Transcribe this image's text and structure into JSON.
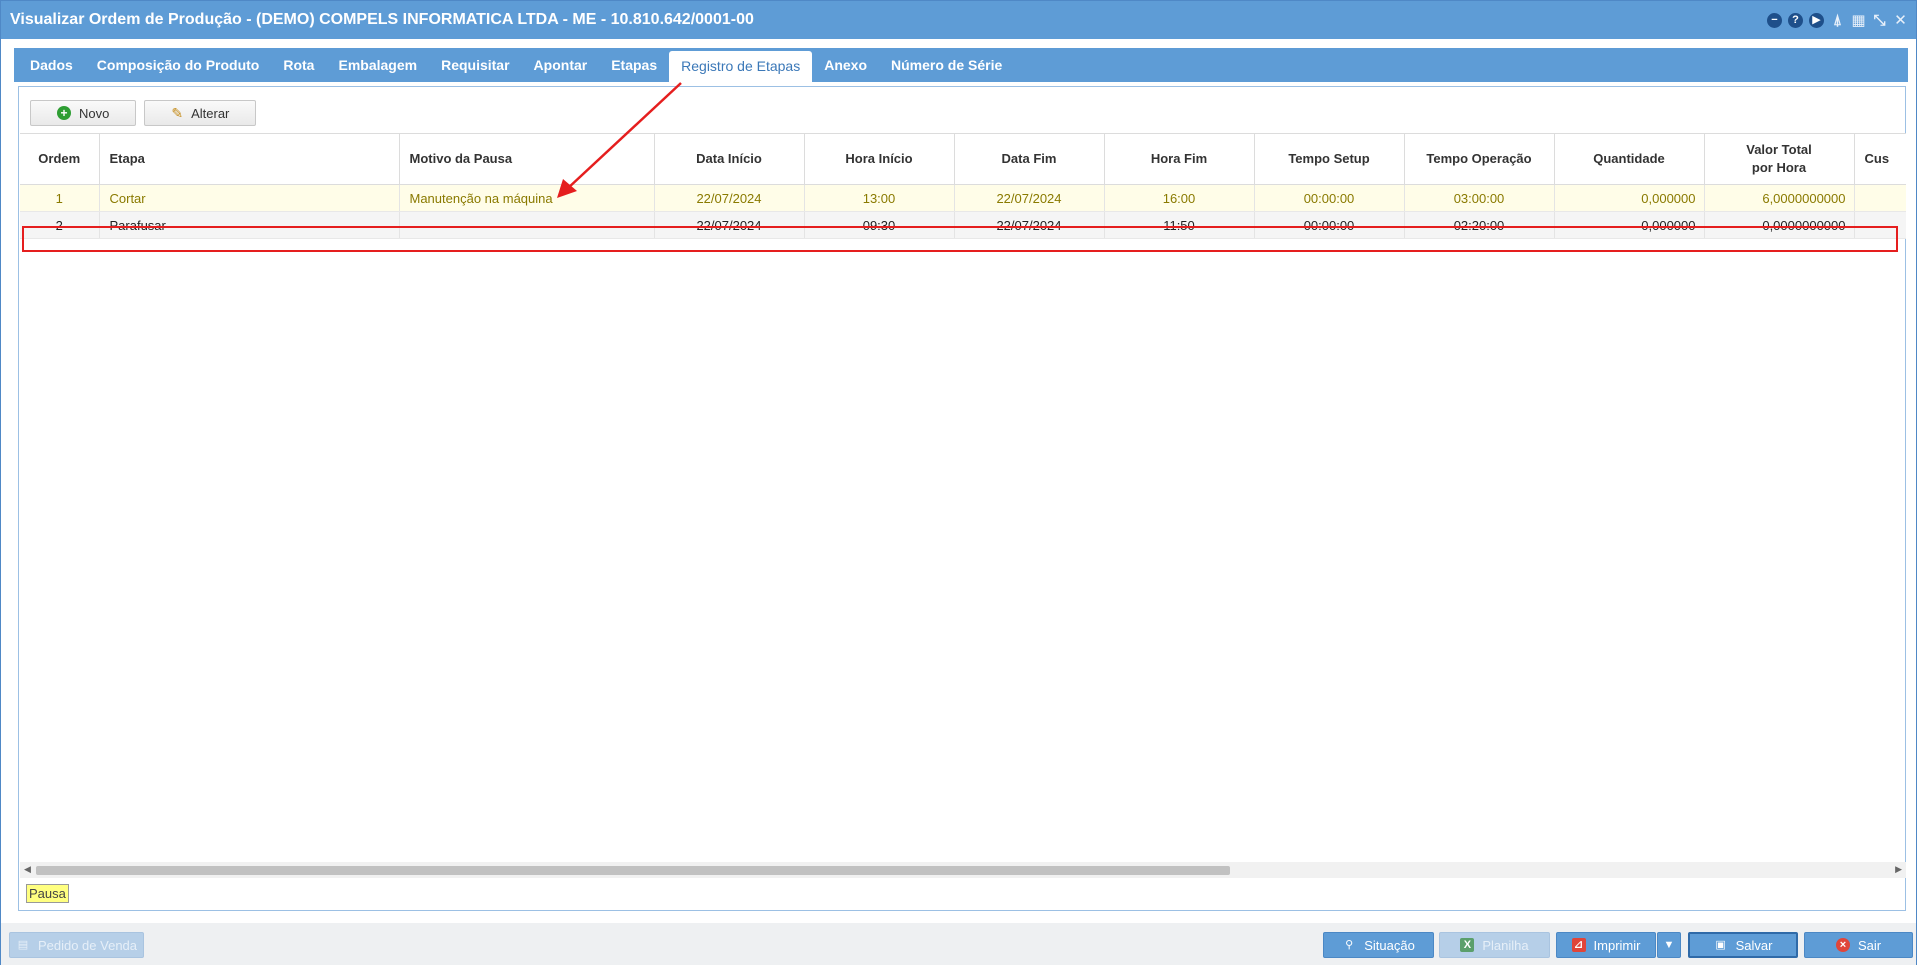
{
  "window": {
    "title": "Visualizar Ordem de Produção - (DEMO) COMPELS INFORMATICA LTDA - ME - 10.810.642/0001-00",
    "icons": [
      "minimize-circle-icon",
      "help-icon",
      "play-icon",
      "bell-icon",
      "calendar-icon",
      "collapse-icon",
      "close-icon"
    ]
  },
  "tabs": [
    {
      "label": "Dados"
    },
    {
      "label": "Composição do Produto"
    },
    {
      "label": "Rota"
    },
    {
      "label": "Embalagem"
    },
    {
      "label": "Requisitar"
    },
    {
      "label": "Apontar"
    },
    {
      "label": "Etapas"
    },
    {
      "label": "Registro de Etapas",
      "active": true
    },
    {
      "label": "Anexo"
    },
    {
      "label": "Número de Série"
    }
  ],
  "toolbar": {
    "new_label": "Novo",
    "edit_label": "Alterar"
  },
  "table": {
    "columns": [
      "Ordem",
      "Etapa",
      "Motivo da Pausa",
      "Data Início",
      "Hora Início",
      "Data Fim",
      "Hora Fim",
      "Tempo Setup",
      "Tempo Operação",
      "Quantidade",
      "Valor Total\npor Hora",
      "Cus"
    ],
    "rows": [
      {
        "ordem": "1",
        "etapa": "Cortar",
        "motivo": "Manutenção na máquina",
        "data_inicio": "22/07/2024",
        "hora_inicio": "13:00",
        "data_fim": "22/07/2024",
        "hora_fim": "16:00",
        "tempo_setup": "00:00:00",
        "tempo_operacao": "03:00:00",
        "quantidade": "0,000000",
        "valor_total": "6,0000000000",
        "status": "paused"
      },
      {
        "ordem": "2",
        "etapa": "Parafusar",
        "motivo": "",
        "data_inicio": "22/07/2024",
        "hora_inicio": "09:30",
        "data_fim": "22/07/2024",
        "hora_fim": "11:50",
        "tempo_setup": "00:00:00",
        "tempo_operacao": "02:20:00",
        "quantidade": "0,000000",
        "valor_total": "0,0000000000",
        "status": "normal"
      }
    ]
  },
  "legend": {
    "label": "Pausa",
    "color": "#ffff80"
  },
  "footer": {
    "sales_order_label": "Pedido de Venda",
    "situation_label": "Situação",
    "spreadsheet_label": "Planilha",
    "print_label": "Imprimir",
    "save_label": "Salvar",
    "exit_label": "Sair"
  },
  "colors": {
    "accent": "#5e9cd6",
    "highlight": "#e51e1e",
    "paused_text": "#8a7a00"
  }
}
